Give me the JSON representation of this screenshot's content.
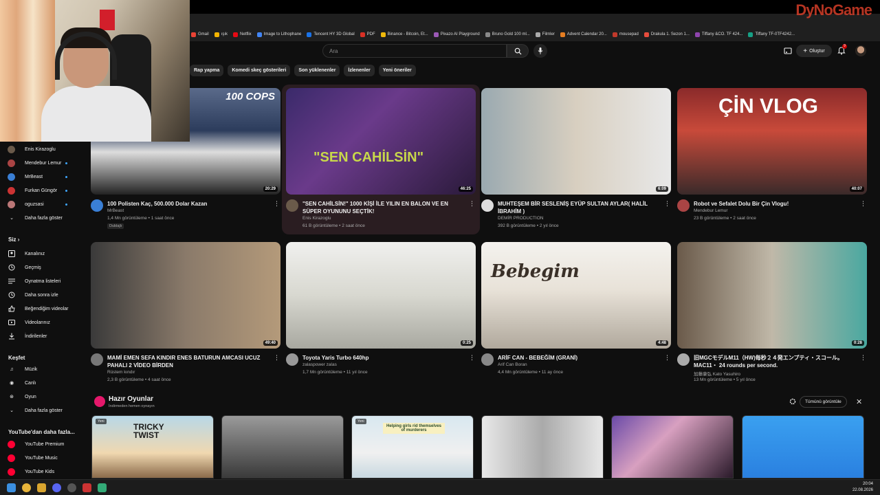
{
  "bookmarks": [
    "Gmail",
    "ışık",
    "Netflix",
    "Image to Lithophane",
    "Tencent HY 3D Global",
    "PDF",
    "Binance - Bitcoin, Et...",
    "Pixazo AI Playground",
    "Bruno Gold 100 ml...",
    "Filmler",
    "Advent Calendar 20...",
    "mousepad",
    "Drakula 1. Sezon 1...",
    "Tiffany &CO. TF 424...",
    "Tiffany TF-0TF4242..."
  ],
  "watermark": "DyNoGame",
  "search": {
    "placeholder": "Ara"
  },
  "create_label": "Oluştur",
  "notifications_count": "9",
  "chips": [
    "Rap yapma",
    "Komedi skeç gösterileri",
    "Son yüklenenler",
    "İzlenenler",
    "Yeni öneriler"
  ],
  "sidebar": {
    "subscriptions": [
      "Enis Kirazoglu",
      "Mendebur Lemur",
      "MrBeast",
      "Furkan Güngör",
      "oguzsasi"
    ],
    "show_more": "Daha fazla göster",
    "you_header": "Siz",
    "you_items": [
      "Kanalınız",
      "Geçmiş",
      "Oynatma listeleri",
      "Daha sonra izle",
      "Beğendiğim videolar",
      "Videolarınız",
      "İndirilenler"
    ],
    "explore_header": "Keşfet",
    "explore_items": [
      "Müzik",
      "Canlı",
      "Oyun"
    ],
    "explore_more": "Daha fazla göster",
    "more_header": "YouTube'dan daha fazla...",
    "more_items": [
      "YouTube Premium",
      "YouTube Music",
      "YouTube Kids"
    ]
  },
  "videos": [
    {
      "title": "100 Polisten Kaç, 500.000 Dolar Kazan",
      "channel": "MrBeast",
      "meta": "1,4 Mn görüntüleme • 1 saat önce",
      "duration": "20:29",
      "badge": "Dublajlı",
      "overlay": "100 COPS"
    },
    {
      "title": "\"SEN CAHİLSİN!\" 1000 KİŞİ İLE YILIN EN BALON VE EN SÜPER OYUNUNU SEÇTİK!",
      "channel": "Enis Kirazoglu",
      "meta": "61 B görüntüleme • 2 saat önce",
      "duration": "46:25",
      "overlay": "\"SEN CAHİLSİN\""
    },
    {
      "title": "MUHTEŞEM BİR SESLENİŞ  EYÜP SULTAN  AYLAR(  HALİL İBRAHİM )",
      "channel": "DEMİR PRODUCTION",
      "meta": "392 B görüntüleme • 2 yıl önce",
      "duration": "6:09"
    },
    {
      "title": "Robot ve Sefalet Dolu Bir Çin Vlogu!",
      "channel": "Mendebur Lemur",
      "meta": "23 B görüntüleme • 2 saat önce",
      "duration": "40:07",
      "overlay": "ÇİN VLOG"
    },
    {
      "title": "MAMİ EMEN SEFA KINDIR ENES BATURUN AMCASI UCUZ PAHALI 2 VİDEO BİRDEN",
      "channel": "Rüstem kındır",
      "meta": "2,3 B görüntüleme • 4 saat önce",
      "duration": "49:40"
    },
    {
      "title": "Toyota Yaris Turbo 640hp",
      "channel": "zalaspower zalas",
      "meta": "1,7 Mn görüntüleme • 11 yıl önce",
      "duration": "0:25"
    },
    {
      "title": "ARİF CAN - BEBEĞİM (GRANİ)",
      "channel": "Arif Can Boran",
      "meta": "4,4 Mn görüntüleme • 11 ay önce",
      "duration": "4:48",
      "overlay": "Bebegim"
    },
    {
      "title": "旧MGCモデルM11（HW)毎秒２４発エンプティ・スコール。 MAC11・ 24 rounds per second.",
      "channel": "加藤康弘  Kato Yasuhiro",
      "meta": "13 Mn görüntüleme • 5 yıl önce",
      "duration": "0:28"
    }
  ],
  "games": {
    "title": "Hazır Oyunlar",
    "subtitle": "İndirmeden hemen oynayın",
    "show_all": "Tümünü görüntüle",
    "items": [
      {
        "new": "Yeni",
        "label": "TRICKY TWIST"
      },
      {
        "new": "",
        "label": ""
      },
      {
        "new": "Yeni",
        "label": "Helping girls rid themselves of murderers"
      },
      {
        "new": "",
        "label": ""
      },
      {
        "new": "",
        "label": ""
      },
      {
        "new": "",
        "label": ""
      }
    ]
  },
  "clock": {
    "time": "20:04",
    "date": "22.08.2026"
  },
  "colors": {
    "accent_red": "#ff0033",
    "live_blue": "#3ea6ff"
  }
}
